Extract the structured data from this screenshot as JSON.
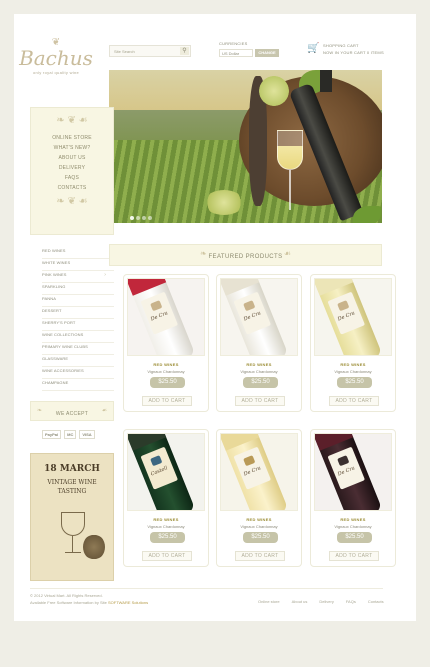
{
  "brand": {
    "name": "Bachus",
    "tagline": "only royal quality wine"
  },
  "search": {
    "placeholder": "Site Search",
    "button_icon": "magnifier"
  },
  "currency": {
    "label": "CURRENCIES",
    "selected": "US Dollar",
    "button": "CHANGE"
  },
  "cart": {
    "title": "SHOPPING CART",
    "summary": "NOW IN YOUR CART 0 ITEMS"
  },
  "hero": {
    "slides": 4,
    "active_slide": 1
  },
  "nav": {
    "items": [
      "ONLINE STORE",
      "WHAT'S NEW?",
      "ABOUT US",
      "DELIVERY",
      "FAQS",
      "CONTACTS"
    ]
  },
  "categories": [
    "RED WINES",
    "WHITE WINES",
    "PINK WINES",
    "SPARKLING",
    "PANNA",
    "DESSERT",
    "SHERRY'S PORT",
    "WINE COLLECTIONS",
    "PRIMARY WINE CLUBS",
    "GLASSWARE",
    "WINE ACCESSORIES",
    "CHAMPAGNE"
  ],
  "accept": {
    "title": "WE ACCEPT",
    "cards": [
      "PayPal",
      "MC",
      "VISA"
    ]
  },
  "promo": {
    "date": "18 MARCH",
    "line1": "VINTAGE WINE",
    "line2": "TASTING"
  },
  "featured": {
    "title": "FEATURED PRODUCTS"
  },
  "products": [
    {
      "category": "RED WINES",
      "name": "Vignaux Chardonnay",
      "price": "$25.50",
      "button": "ADD TO CART"
    },
    {
      "category": "RED WINES",
      "name": "Vignaux Chardonnay",
      "price": "$25.50",
      "button": "ADD TO CART"
    },
    {
      "category": "RED WINES",
      "name": "Vignaux Chardonnay",
      "price": "$25.50",
      "button": "ADD TO CART"
    },
    {
      "category": "RED WINES",
      "name": "Vignaux Chardonnay",
      "price": "$25.50",
      "button": "ADD TO CART"
    },
    {
      "category": "RED WINES",
      "name": "Vignaux Chardonnay",
      "price": "$25.50",
      "button": "ADD TO CART"
    },
    {
      "category": "RED WINES",
      "name": "Vignaux Chardonnay",
      "price": "$25.50",
      "button": "ADD TO CART"
    }
  ],
  "footer": {
    "copyright": "© 2012 Virtual Mart. All Rights Reserved.",
    "more_text": "Available Free Software Information by Site",
    "more_link": "SOFTWARE Solutions",
    "links": [
      "Online store",
      "About us",
      "Delivery",
      "FAQs",
      "Contacts"
    ]
  },
  "colors": {
    "accent": "#9b8c34",
    "panel": "#f8f6e3",
    "price_button": "#c6c4a8"
  }
}
